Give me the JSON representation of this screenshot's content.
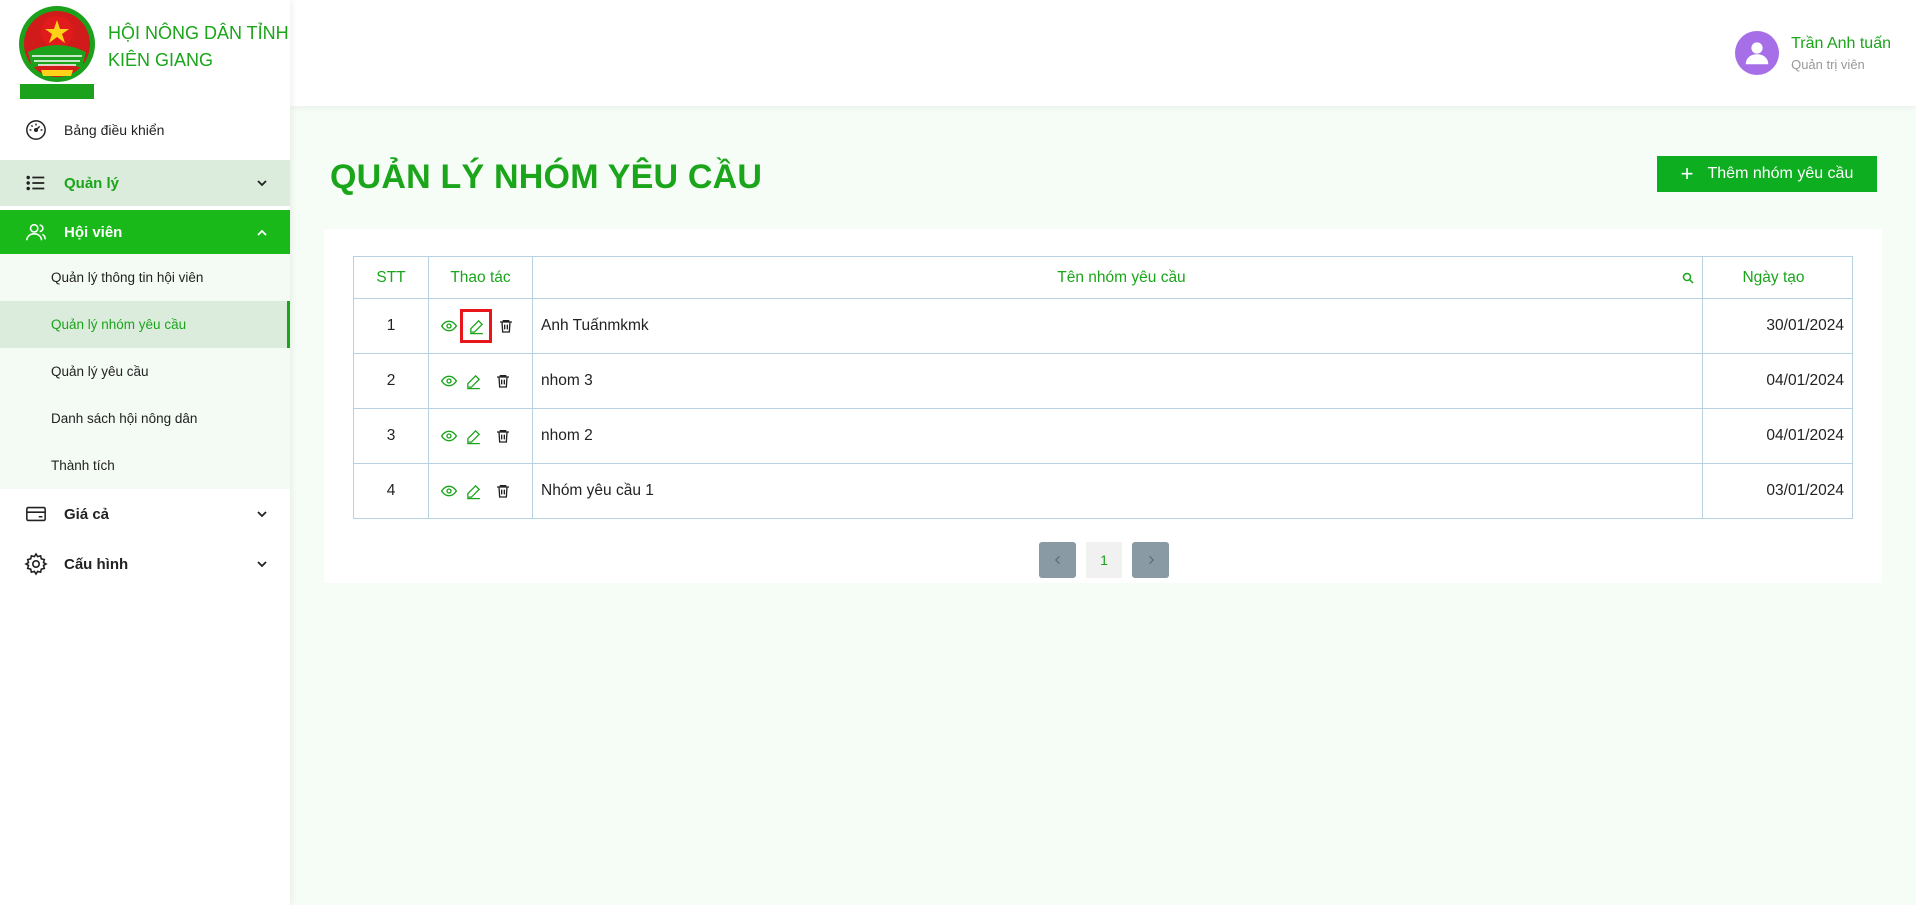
{
  "brand": {
    "title_line1": "HỘI NÔNG DÂN TỈNH",
    "title_line2": "KIÊN GIANG",
    "logo_text_top": "HỘI NÔNG DÂN",
    "logo_text_bottom": "TỈNH KIÊN GIANG"
  },
  "sidebar": {
    "dashboard": "Bảng điều khiển",
    "quanly": "Quản lý",
    "hoivien": "Hội viên",
    "sub_items": [
      "Quản lý thông tin hội viên",
      "Quản lý nhóm yêu cầu",
      "Quản lý yêu cầu",
      "Danh sách hội nông dân",
      "Thành tích"
    ],
    "giaca": "Giá cả",
    "cauhinh": "Cấu hình"
  },
  "user": {
    "name": "Trần Anh tuấn",
    "role": "Quản trị viên"
  },
  "page": {
    "title": "QUẢN LÝ NHÓM YÊU CẦU",
    "add_button": "Thêm nhóm yêu cầu"
  },
  "table": {
    "headers": [
      "STT",
      "Thao tác",
      "Tên nhóm yêu cầu",
      "Ngày tạo"
    ],
    "rows": [
      {
        "stt": "1",
        "name": "Anh Tuấnmkmk",
        "date": "30/01/2024"
      },
      {
        "stt": "2",
        "name": "nhom 3",
        "date": "04/01/2024"
      },
      {
        "stt": "3",
        "name": "nhom 2",
        "date": "04/01/2024"
      },
      {
        "stt": "4",
        "name": "Nhóm yêu cầu 1",
        "date": "03/01/2024"
      }
    ]
  },
  "pagination": {
    "current_page": "1"
  },
  "colors": {
    "primary": "#1aa51a",
    "button": "#0dae1f",
    "active_bg": "#dbebdc",
    "highlight": "#e8161b"
  }
}
